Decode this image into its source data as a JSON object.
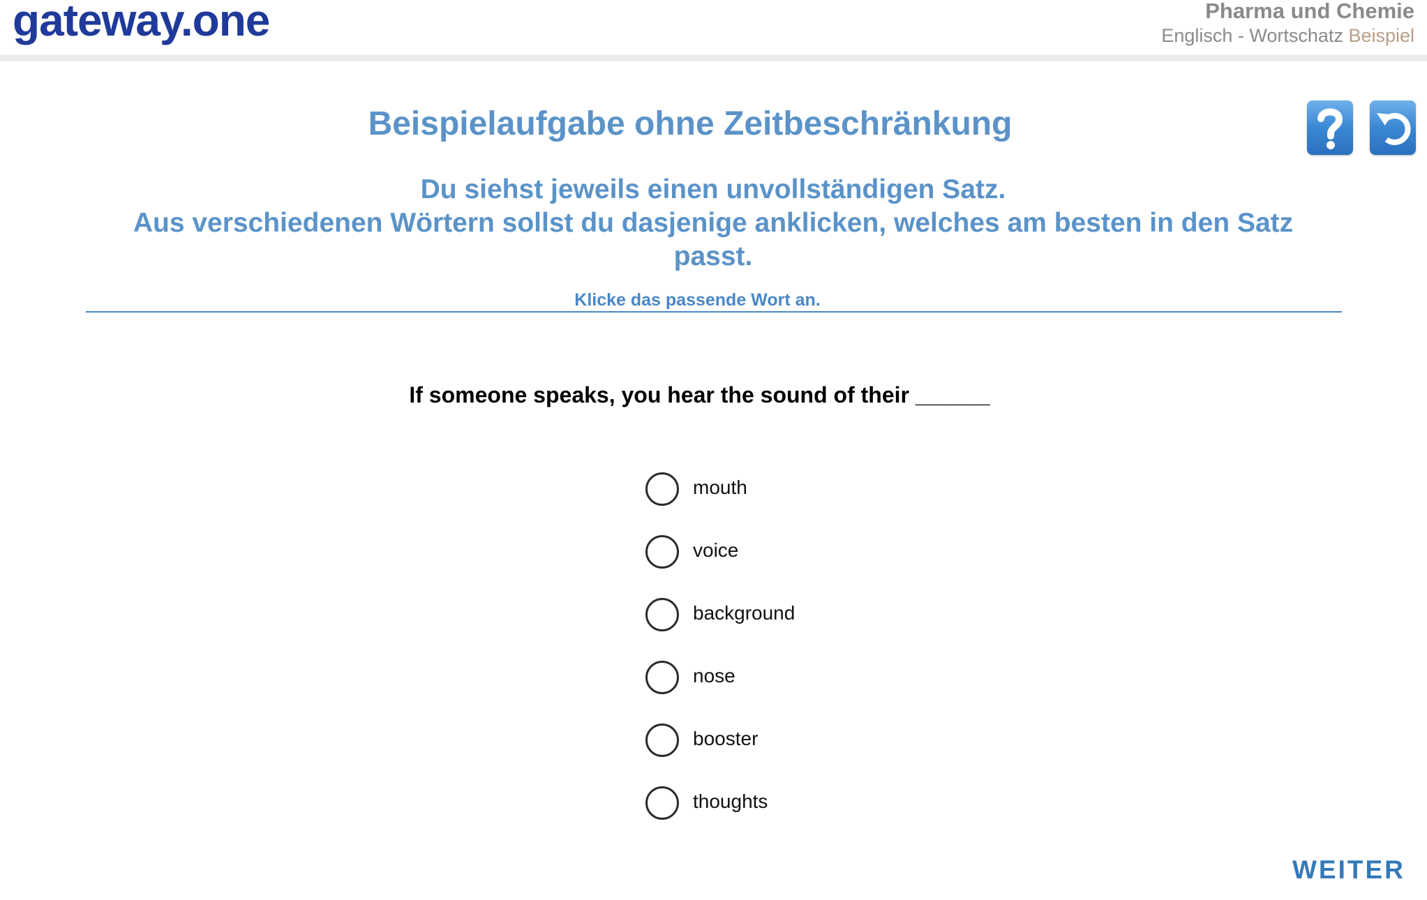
{
  "header": {
    "logo": "gateway.one",
    "title": "Pharma und Chemie",
    "subtitle": "Englisch - Wortschatz",
    "tag": "Beispiel"
  },
  "toolbar": {
    "help_icon": "question-mark-icon",
    "reset_icon": "undo-icon"
  },
  "main": {
    "title": "Beispielaufgabe ohne Zeitbeschränkung",
    "instruction_line1": "Du siehst jeweils einen unvollständigen Satz.",
    "instruction_line2": "Aus verschiedenen Wörtern sollst du dasjenige anklicken, welches am besten in den Satz passt.",
    "hint": "Klicke das passende Wort an."
  },
  "question": {
    "text": "If someone speaks, you hear the sound of their ______"
  },
  "options": [
    {
      "label": "mouth"
    },
    {
      "label": "voice"
    },
    {
      "label": "background"
    },
    {
      "label": "nose"
    },
    {
      "label": "booster"
    },
    {
      "label": "thoughts"
    }
  ],
  "footer": {
    "next_label": "WEITER"
  },
  "colors": {
    "logo": "#1f3a9a",
    "accent": "#5b93c8",
    "button": "#3a88d4",
    "tag": "#b89e86"
  }
}
